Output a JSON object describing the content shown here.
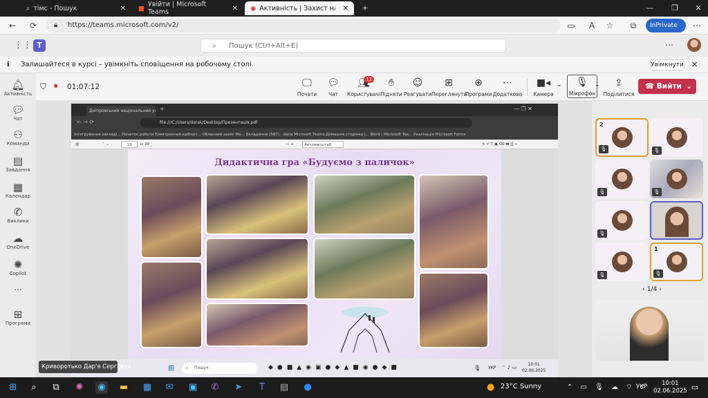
{
  "browser": {
    "tabs": [
      {
        "title": "тімс - Пошук",
        "icon": "search-icon"
      },
      {
        "title": "Увійти | Microsoft Teams",
        "icon": "windows-logo-icon"
      },
      {
        "title": "Активність | Захист навчал",
        "icon": "teams-icon",
        "active": true
      }
    ],
    "url": "https://teams.microsoft.com/v2/",
    "inprivate": "InPrivate"
  },
  "teams": {
    "search_placeholder": "Пошук (Ctrl+Alt+E)",
    "notification": "Залишайтеся в курсі – увімкніть сповіщення на робочому столі.",
    "notification_button": "Увімкнути"
  },
  "rail": [
    {
      "label": "Активність",
      "icon": "bell-icon"
    },
    {
      "label": "Чат",
      "icon": "chat-icon"
    },
    {
      "label": "Команди",
      "icon": "teams-group-icon"
    },
    {
      "label": "Завдання",
      "icon": "assignments-icon"
    },
    {
      "label": "Календар",
      "icon": "calendar-icon"
    },
    {
      "label": "Виклики",
      "icon": "phone-icon"
    },
    {
      "label": "OneDrive",
      "icon": "cloud-icon"
    },
    {
      "label": "Copilot",
      "icon": "copilot-icon"
    },
    {
      "label": "Програми",
      "icon": "plus-icon"
    }
  ],
  "meeting": {
    "timer": "01:07:12",
    "controls": [
      {
        "label": "Почати",
        "icon": "share-screen-icon"
      },
      {
        "label": "Чат",
        "icon": "chat-icon"
      },
      {
        "label": "Користувачі",
        "icon": "people-icon",
        "badge": "12"
      },
      {
        "label": "Підняти",
        "icon": "hand-icon"
      },
      {
        "label": "Реагувати",
        "icon": "smile-icon"
      },
      {
        "label": "Переглянути",
        "icon": "view-icon"
      },
      {
        "label": "Програми",
        "icon": "apps-icon"
      },
      {
        "label": "Додатково",
        "icon": "more-icon"
      },
      {
        "label": "Камера",
        "icon": "camera-icon"
      },
      {
        "label": "Мікрофон",
        "icon": "mic-icon"
      },
      {
        "label": "Поділитися",
        "icon": "share-icon"
      }
    ],
    "leave_label": "Вийти",
    "presenter_name": "Криворотько Дар'я Сергіївна",
    "pager": "1/4"
  },
  "shared_screen": {
    "tab_title": "Дніпровський національний унів",
    "url": "file:///C:/Users/darak/Desktop/Презентація.pdf",
    "bookmarks": "Інтегрування закладі...  Початок роботи  Електронний кабінет...  Обласний захис Ме...  Вкладення (587) - daria  Microsoft Teams  Домашня сторінка |...  Word | Microsoft Tea...  Реалізація  Microsoft Forms",
    "page_current": "13",
    "page_total": "із 28",
    "zoom": "Автомасштаб",
    "slide_title": "Дидактична гра «Будуємо з паличок»",
    "taskbar_search": "Пошук",
    "lang": "УКР",
    "time": "10:01",
    "date": "02.06.2025"
  },
  "participants": [
    {
      "num": "2",
      "highlight": "active"
    },
    {
      "num": ""
    },
    {
      "num": ""
    },
    {
      "num": ""
    },
    {
      "num": ""
    },
    {
      "num": "",
      "highlight": "video"
    },
    {
      "num": ""
    },
    {
      "num": "1",
      "highlight": "active"
    }
  ],
  "taskbar": {
    "weather": "23°C  Sunny",
    "lang": "УКР",
    "time": "10:01",
    "date": "02.06.2025"
  },
  "colors": {
    "accent": "#5b5fc7",
    "leave": "#c4314b",
    "highlight": "#e0a030"
  }
}
